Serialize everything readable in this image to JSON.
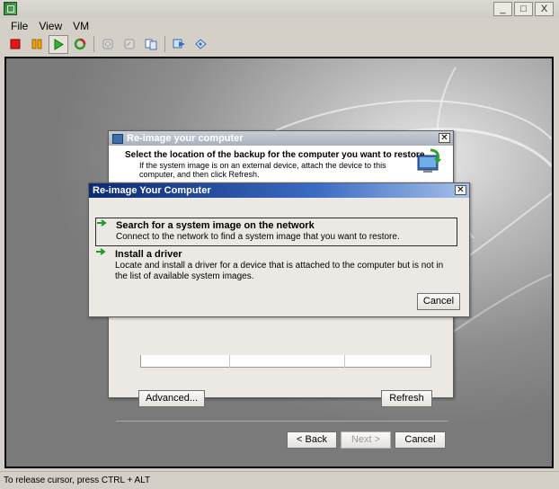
{
  "window": {
    "min_label": "_",
    "max_label": "□",
    "close_label": "X"
  },
  "menu": {
    "items": [
      "File",
      "View",
      "VM"
    ]
  },
  "toolbar": {
    "icons": [
      "stop-icon",
      "pause-icon",
      "play-icon",
      "reset-icon",
      "snapshot-icon",
      "revert-snapshot-icon",
      "manage-snapshots-icon",
      "send-ctrl-alt-del-icon",
      "fullscreen-icon"
    ]
  },
  "back_dialog": {
    "title": "Re-image your computer",
    "heading": "Select the location of the backup for the computer you want to restore",
    "desc": "If the system image is on an external device, attach the device to this computer, and then click Refresh.",
    "advanced_label": "Advanced...",
    "refresh_label": "Refresh",
    "back_label": "< Back",
    "next_label": "Next >",
    "cancel_label": "Cancel"
  },
  "front_dialog": {
    "title": "Re-image Your Computer",
    "options": [
      {
        "title": "Search for a system image on the network",
        "desc": "Connect to the network to find a system image that you want to restore."
      },
      {
        "title": "Install a driver",
        "desc": "Locate and install a driver for a device that is attached to the computer but is not in the list of available system images."
      }
    ],
    "cancel_label": "Cancel"
  },
  "status_text": "To release cursor, press CTRL + ALT",
  "colors": {
    "title_active": "#1a3e8a",
    "arrow_green": "#1d9a2a"
  }
}
